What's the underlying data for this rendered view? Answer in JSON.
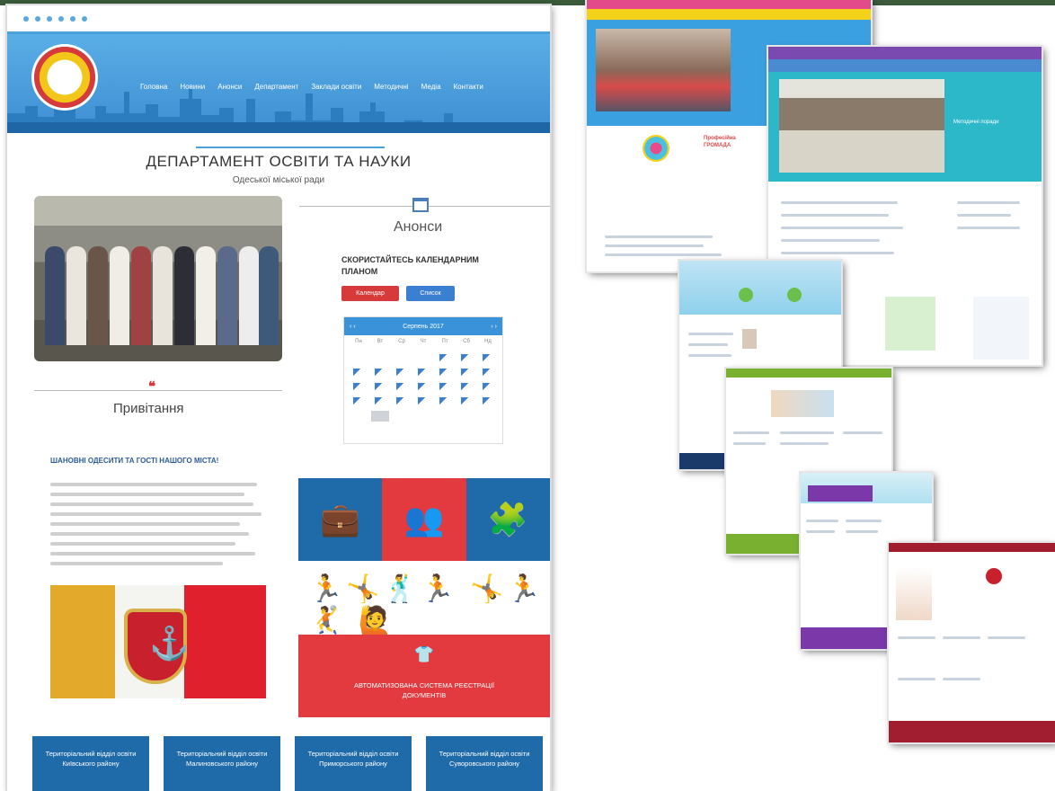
{
  "main_site": {
    "nav_items": [
      "Головна",
      "Новини",
      "Анонси",
      "Департамент",
      "Заклади освіти",
      "Методичні",
      "Медіа",
      "Контакти"
    ],
    "title": "ДЕПАРТАМЕНТ ОСВІТИ ТА НАУКИ",
    "subtitle": "Одеської міської ради",
    "announcements_heading": "Анонси",
    "calendar_prompt": "СКОРИСТАЙТЕСЬ КАЛЕНДАРНИМ ПЛАНОМ",
    "calendar_button": "Календар",
    "list_button": "Список",
    "calendar_month": "Серпень 2017",
    "calendar_weekdays": [
      "Пн",
      "Вт",
      "Ср",
      "Чт",
      "Пт",
      "Сб",
      "Нд"
    ],
    "greetings_heading": "Привітання",
    "greetings_subheading": "ШАНОВНІ ОДЕСИТИ ТА ГОСТІ НАШОГО МІСТА!",
    "registration_label": "АВТОМАТИЗОВАНА СИСТЕМА РЕЄСТРАЦІЇ ДОКУМЕНТІВ",
    "districts": [
      "Територіальний відділ освіти Київського району",
      "Територіальний відділ освіти Малиновського району",
      "Територіальний відділ освіти Приморського району",
      "Територіальний відділ освіти Суворовського району"
    ]
  },
  "thumbnails": {
    "s1_heading": "Професійна ГРОМАДА",
    "s2_banner": "Методичні поради"
  },
  "colors": {
    "primary_blue": "#1f6aa8",
    "accent_red": "#e23a3e",
    "header_blue": "#4aa0d8"
  }
}
